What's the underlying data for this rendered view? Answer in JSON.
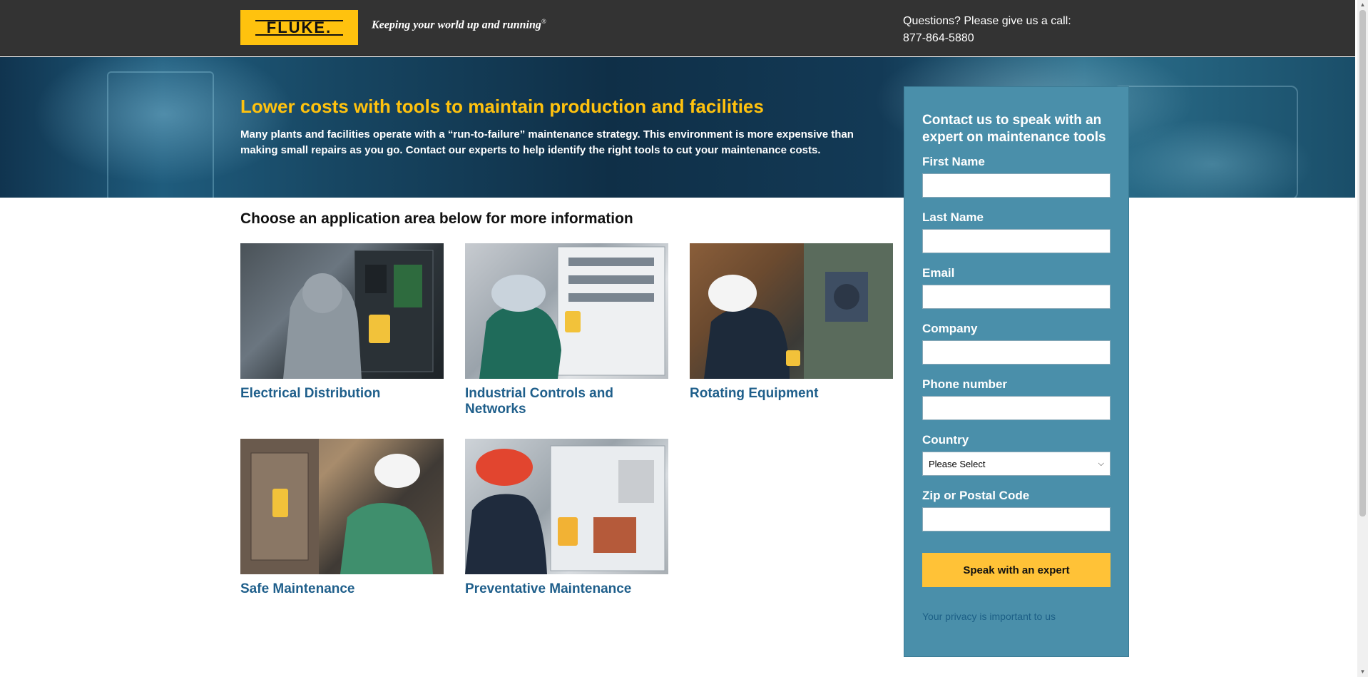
{
  "header": {
    "logo_text": "FLUKE.",
    "tagline": "Keeping your world up and running",
    "tagline_mark": "®",
    "call_line1": "Questions? Please give us a call:",
    "call_line2": "877-864-5880"
  },
  "hero": {
    "title": "Lower costs with tools to maintain production and facilities",
    "description": "Many plants and facilities operate with a “run-to-failure” maintenance strategy. This environment is more expensive than making small repairs as you go. Contact our experts to help identify the right tools to cut your maintenance costs."
  },
  "main": {
    "section_title": "Choose an application area below for more information",
    "cards": [
      {
        "title": "Electrical Distribution"
      },
      {
        "title": "Industrial Controls and Networks"
      },
      {
        "title": "Rotating Equipment"
      },
      {
        "title": "Safe Maintenance"
      },
      {
        "title": "Preventative Maintenance"
      }
    ]
  },
  "form": {
    "title": "Contact us to speak with an expert on maintenance tools",
    "first_name_label": "First Name",
    "last_name_label": "Last Name",
    "email_label": "Email",
    "company_label": "Company",
    "phone_label": "Phone number",
    "country_label": "Country",
    "country_selected": "Please Select",
    "zip_label": "Zip or Postal Code",
    "submit_label": "Speak with an expert",
    "privacy_link": "Your privacy is important to us"
  },
  "icons": {
    "select_chevron": "chevron-down-icon",
    "scroll_up": "arrow-up-icon",
    "scroll_down": "arrow-down-icon"
  },
  "colors": {
    "header_bg": "#333333",
    "brand_yellow": "#ffc20e",
    "form_bg": "#4a8faa",
    "link_blue": "#1f5f8b",
    "button_yellow": "#ffc237"
  }
}
